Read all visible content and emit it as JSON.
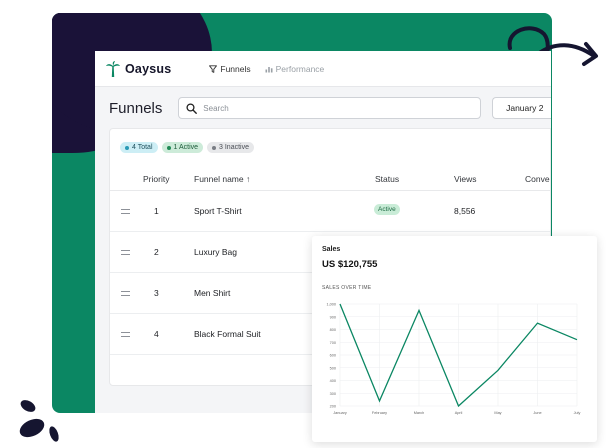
{
  "brand": {
    "name": "Oaysus",
    "accent": "#0b8763",
    "dark": "#1a1238"
  },
  "nav": {
    "items": [
      {
        "label": "Funnels",
        "icon": "funnel-icon",
        "active": true
      },
      {
        "label": "Performance",
        "icon": "bar-chart-icon",
        "active": false
      }
    ]
  },
  "page": {
    "title": "Funnels",
    "search_placeholder": "Search",
    "date_label": "January 2"
  },
  "filters": {
    "total": "4 Total",
    "active": "1 Active",
    "inactive": "3 Inactive"
  },
  "table": {
    "headers": {
      "priority": "Priority",
      "name": "Funnel name ↑",
      "status": "Status",
      "views": "Views",
      "conversion": "Conve"
    },
    "rows": [
      {
        "priority": "1",
        "name": "Sport T-Shirt",
        "status": "Active",
        "views": "8,556"
      },
      {
        "priority": "2",
        "name": "Luxury Bag",
        "status": "",
        "views": ""
      },
      {
        "priority": "3",
        "name": "Men Shirt",
        "status": "",
        "views": ""
      },
      {
        "priority": "4",
        "name": "Black Formal Suit",
        "status": "",
        "views": ""
      }
    ]
  },
  "sales": {
    "label": "Sales",
    "total": "US $120,755",
    "subtitle": "SALES OVER TIME"
  },
  "chart_data": {
    "type": "line",
    "title": "SALES OVER TIME",
    "categories": [
      "January",
      "February",
      "March",
      "April",
      "May",
      "June",
      "July"
    ],
    "series": [
      {
        "values": [
          1000,
          240,
          950,
          200,
          480,
          850,
          720
        ],
        "color": "#0b8763"
      }
    ],
    "ylim": [
      200,
      1000
    ],
    "yticks": [
      "1,000",
      "900",
      "800",
      "700",
      "600",
      "500",
      "400",
      "300",
      "200"
    ],
    "grid": true
  }
}
